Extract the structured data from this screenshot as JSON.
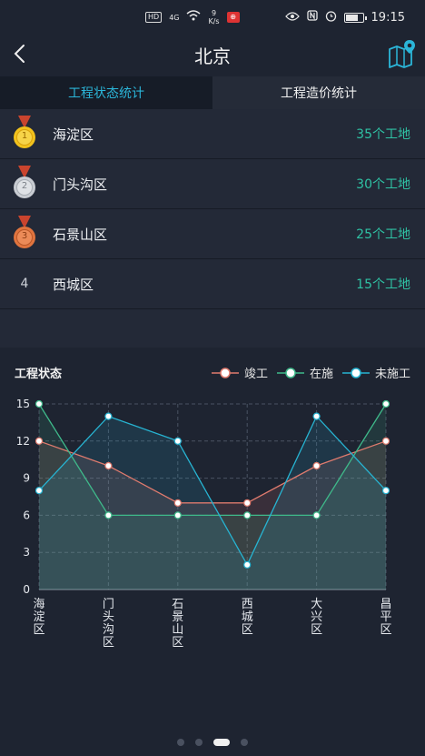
{
  "statusbar": {
    "hd": "HD",
    "network": "4G",
    "speed_value": "9",
    "speed_unit": "K/s",
    "time": "19:15"
  },
  "navbar": {
    "title": "北京"
  },
  "tabs": [
    {
      "label": "工程状态统计",
      "active": true
    },
    {
      "label": "工程造价统计",
      "active": false
    }
  ],
  "ranking": [
    {
      "rank": "1",
      "name": "海淀区",
      "count": "35个工地",
      "medal": "gold"
    },
    {
      "rank": "2",
      "name": "门头沟区",
      "count": "30个工地",
      "medal": "silver"
    },
    {
      "rank": "3",
      "name": "石景山区",
      "count": "25个工地",
      "medal": "bronze"
    },
    {
      "rank": "4",
      "name": "西城区",
      "count": "15个工地",
      "medal": "none"
    }
  ],
  "chart_panel": {
    "title": "工程状态"
  },
  "colors": {
    "completed": "#e07b6e",
    "in_progress": "#3fb98a",
    "not_started": "#27b4d2",
    "accent": "#2bb6d9",
    "count_text": "#2fc2a4"
  },
  "chart_data": {
    "type": "line",
    "categories": [
      "海淀区",
      "门头沟区",
      "石景山区",
      "西城区",
      "大兴区",
      "昌平区"
    ],
    "series": [
      {
        "name": "竣工",
        "values": [
          12,
          10,
          7,
          7,
          10,
          12
        ]
      },
      {
        "name": "在施",
        "values": [
          15,
          6,
          6,
          6,
          6,
          15
        ]
      },
      {
        "name": "未施工",
        "values": [
          8,
          14,
          12,
          2,
          14,
          8
        ]
      }
    ],
    "yticks": [
      0,
      3,
      6,
      9,
      12,
      15
    ],
    "ylim": [
      0,
      15
    ],
    "grid": true,
    "legend": "top-right"
  },
  "pager": {
    "count": 4,
    "active": 2
  }
}
